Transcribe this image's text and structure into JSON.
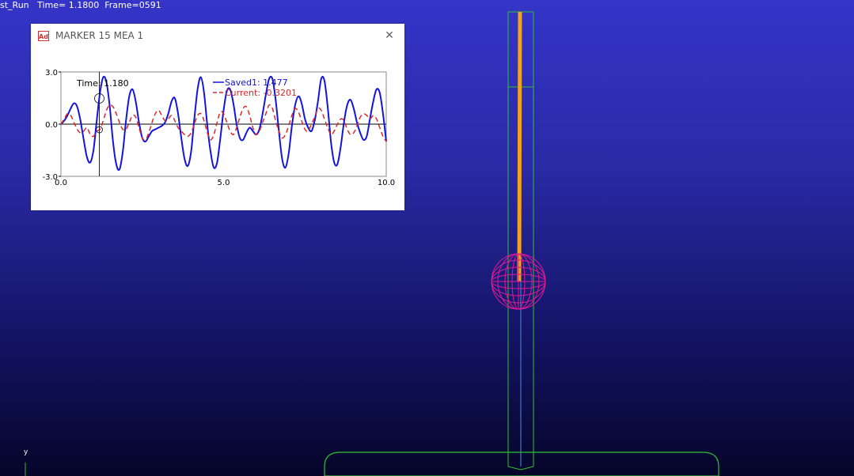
{
  "status_bar": {
    "text": "st_Run   Time= 1.1800  Frame=0591"
  },
  "plot_window": {
    "icon_text": "Ad",
    "title": "MARKER 15 MEA 1",
    "close_icon": "close-icon"
  },
  "chart_data": {
    "type": "line",
    "x_range": [
      0.0,
      10.0
    ],
    "y_range": [
      -3.0,
      3.0
    ],
    "x_ticks": [
      "0.0",
      "5.0",
      "10.0"
    ],
    "y_ticks": [
      "3.0",
      "0.0",
      "-3.0"
    ],
    "cursor": {
      "label": "Time: 1.180",
      "x": 1.18
    },
    "series": [
      {
        "name": "Saved1",
        "legend": "Saved1: 1.477",
        "color": "#1414dc",
        "style": "solid",
        "x": [
          0.0,
          0.1,
          0.2,
          0.3,
          0.4,
          0.5,
          0.6,
          0.7,
          0.8,
          0.9,
          1.0,
          1.1,
          1.2,
          1.3,
          1.4,
          1.5,
          1.6,
          1.7,
          1.8,
          1.9,
          2.0,
          2.1,
          2.2,
          2.3,
          2.4,
          2.5,
          2.6,
          2.7,
          2.8,
          2.9,
          3.0,
          3.1,
          3.2,
          3.3,
          3.4,
          3.5,
          3.6,
          3.7,
          3.8,
          3.9,
          4.0,
          4.1,
          4.2,
          4.3,
          4.4,
          4.5,
          4.6,
          4.7,
          4.8,
          4.9,
          5.0,
          5.1,
          5.2,
          5.3,
          5.4,
          5.5,
          5.6,
          5.7,
          5.8,
          5.9,
          6.0,
          6.1,
          6.2,
          6.3,
          6.4,
          6.5,
          6.6,
          6.7,
          6.8,
          6.9,
          7.0,
          7.1,
          7.2,
          7.3,
          7.4,
          7.5,
          7.6,
          7.7,
          7.8,
          7.9,
          8.0,
          8.1,
          8.2,
          8.3,
          8.4,
          8.5,
          8.6,
          8.7,
          8.8,
          8.9,
          9.0,
          9.1,
          9.2,
          9.3,
          9.4,
          9.5,
          9.6,
          9.7,
          9.8,
          9.9,
          10.0
        ],
        "y": [
          0.0,
          0.2,
          0.5,
          0.9,
          1.2,
          1.0,
          0.2,
          -0.9,
          -1.9,
          -2.2,
          -1.5,
          0.2,
          1.8,
          2.7,
          2.4,
          1.0,
          -1.0,
          -2.3,
          -2.6,
          -1.6,
          0.2,
          1.6,
          2.0,
          1.3,
          0.1,
          -0.8,
          -1.0,
          -0.7,
          -0.4,
          -0.3,
          -0.2,
          -0.1,
          0.1,
          0.6,
          1.3,
          1.5,
          0.6,
          -0.8,
          -2.0,
          -2.4,
          -1.6,
          0.3,
          2.0,
          2.7,
          1.8,
          -0.1,
          -1.6,
          -2.5,
          -2.2,
          -0.8,
          0.8,
          1.9,
          2.0,
          1.2,
          0.0,
          -0.8,
          -0.9,
          -0.5,
          -0.2,
          -0.4,
          -0.6,
          -0.3,
          0.6,
          1.7,
          2.6,
          2.6,
          1.4,
          -0.4,
          -2.0,
          -2.5,
          -1.7,
          -0.1,
          1.1,
          1.6,
          1.2,
          0.3,
          -0.2,
          -0.4,
          0.2,
          1.3,
          2.6,
          2.5,
          1.0,
          -1.0,
          -2.2,
          -2.3,
          -1.3,
          0.1,
          1.1,
          1.4,
          0.9,
          0.1,
          -0.5,
          -0.9,
          -0.7,
          0.3,
          1.3,
          2.0,
          1.8,
          0.6,
          -1.0
        ]
      },
      {
        "name": "Current",
        "legend": "Current: -0.3201",
        "color": "#e02828",
        "style": "dashed",
        "x": [
          0.0,
          0.1,
          0.2,
          0.3,
          0.4,
          0.5,
          0.6,
          0.7,
          0.8,
          0.9,
          1.0,
          1.1,
          1.2,
          1.3,
          1.4,
          1.5,
          1.6,
          1.7,
          1.8,
          1.9,
          2.0,
          2.1,
          2.2,
          2.3,
          2.4,
          2.5,
          2.6,
          2.7,
          2.8,
          2.9,
          3.0,
          3.1,
          3.2,
          3.3,
          3.4,
          3.5,
          3.6,
          3.7,
          3.8,
          3.9,
          4.0,
          4.1,
          4.2,
          4.3,
          4.4,
          4.5,
          4.6,
          4.7,
          4.8,
          4.9,
          5.0,
          5.1,
          5.2,
          5.3,
          5.4,
          5.5,
          5.6,
          5.7,
          5.8,
          5.9,
          6.0,
          6.1,
          6.2,
          6.3,
          6.4,
          6.5,
          6.6,
          6.7,
          6.8,
          6.9,
          7.0,
          7.1,
          7.2,
          7.3,
          7.4,
          7.5,
          7.6,
          7.7,
          7.8,
          7.9,
          8.0,
          8.1,
          8.2,
          8.3,
          8.4,
          8.5,
          8.6,
          8.7,
          8.8,
          8.9,
          9.0,
          9.1,
          9.2,
          9.3,
          9.4,
          9.5,
          9.6,
          9.7,
          9.8,
          9.9,
          10.0
        ],
        "y": [
          0.0,
          0.3,
          0.6,
          0.5,
          0.1,
          -0.3,
          -0.5,
          -0.4,
          -0.2,
          -0.6,
          -0.7,
          -0.4,
          -0.3,
          0.2,
          0.8,
          1.1,
          1.0,
          0.6,
          0.1,
          -0.3,
          -0.3,
          0.1,
          0.5,
          0.4,
          -0.2,
          -0.8,
          -0.9,
          -0.5,
          0.1,
          0.6,
          0.8,
          0.5,
          0.2,
          0.3,
          0.5,
          0.2,
          -0.2,
          -0.4,
          -0.6,
          -0.7,
          -0.5,
          0.0,
          0.5,
          0.6,
          0.2,
          -0.5,
          -0.9,
          -0.6,
          0.1,
          0.7,
          0.6,
          0.1,
          -0.4,
          -0.6,
          -0.2,
          0.4,
          0.9,
          1.0,
          0.5,
          -0.2,
          -0.6,
          -0.4,
          0.1,
          0.6,
          1.1,
          0.9,
          0.2,
          -0.4,
          -0.8,
          -0.6,
          -0.1,
          0.5,
          0.9,
          0.7,
          0.2,
          -0.3,
          -0.4,
          0.0,
          0.4,
          0.9,
          0.8,
          0.3,
          -0.2,
          -0.6,
          -0.4,
          0.0,
          0.3,
          0.2,
          -0.3,
          -0.6,
          -0.5,
          -0.1,
          0.4,
          0.6,
          0.5,
          0.3,
          0.5,
          0.3,
          -0.2,
          -0.7,
          -1.0
        ]
      }
    ]
  },
  "scene": {
    "link_color": "#f2a21c",
    "ball_color": "#e01890",
    "guide_color": "#2fc02f",
    "axis_triad_label": "y"
  }
}
